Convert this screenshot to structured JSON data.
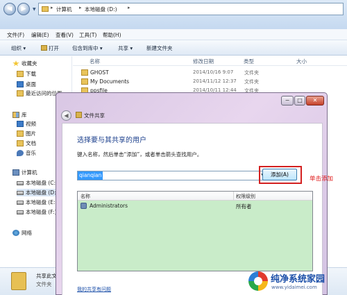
{
  "address": {
    "crumbs": [
      "计算机",
      "本地磁盘 (D:)"
    ]
  },
  "menu": [
    "文件(F)",
    "编辑(E)",
    "查看(V)",
    "工具(T)",
    "帮助(H)"
  ],
  "toolbar": {
    "organize": "组织 ▾",
    "open": "打开",
    "include_library": "包含到库中 ▾",
    "share": "共享 ▾",
    "new_folder": "新建文件夹"
  },
  "sidebar": {
    "favorites": "收藏夹",
    "favorites_items": [
      "下载",
      "桌面",
      "最近访问的位置"
    ],
    "libraries": "库",
    "libraries_items": [
      "视频",
      "图片",
      "文档",
      "音乐"
    ],
    "computer": "计算机",
    "computer_items": [
      "本地磁盘 (C:)",
      "本地磁盘 (D:)",
      "本地磁盘 (E:)",
      "本地磁盘 (F:)"
    ],
    "network": "网络"
  },
  "file_columns": {
    "name": "名称",
    "modified": "修改日期",
    "type": "类型",
    "size": "大小"
  },
  "files": [
    {
      "name": "GHOST",
      "date": "2014/10/16 9:07",
      "type": "文件夹"
    },
    {
      "name": "My Documents",
      "date": "2014/11/12 12:37",
      "type": "文件夹"
    },
    {
      "name": "ppsfile",
      "date": "2014/10/11 12:44",
      "type": "文件夹"
    }
  ],
  "status": {
    "name": "共享此文",
    "type": "文件夹"
  },
  "dialog": {
    "title": "文件共享",
    "heading": "选择要与其共享的用户",
    "instruction": "键入名称，然后单击“添加”，或者单击箭头查找用户。",
    "input_value": "qianqian",
    "add_label": "添加(A)",
    "columns": {
      "name": "名称",
      "permission": "权限级别"
    },
    "users": [
      {
        "name": "Administrators",
        "level": "所有者"
      }
    ],
    "help_link": "我的共享有问题",
    "min": "−",
    "max": "□",
    "close": "✕"
  },
  "annotation": "单击添加",
  "watermark": {
    "title": "纯净系统家园",
    "url": "www.yidaimei.com"
  }
}
